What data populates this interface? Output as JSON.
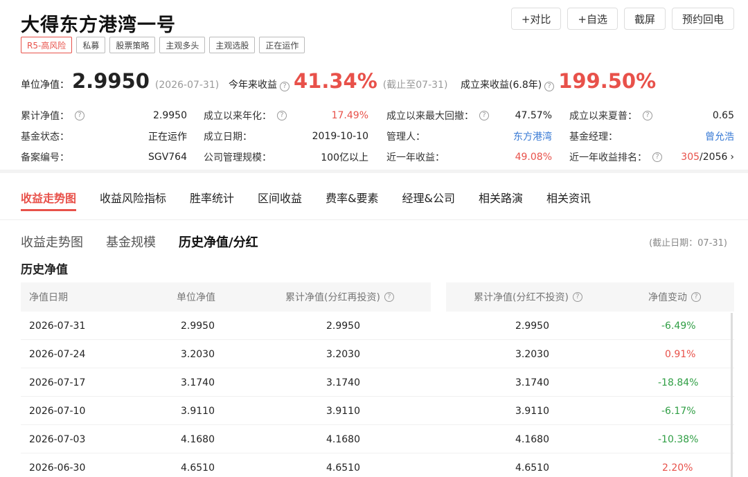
{
  "fund": {
    "title": "大得东方港湾一号",
    "tags": [
      "R5-高风险",
      "私募",
      "股票策略",
      "主观多头",
      "主观选股",
      "正在运作"
    ]
  },
  "actions": [
    "+对比",
    "+自选",
    "截屏",
    "预约回电"
  ],
  "kpis": {
    "nav_label": "单位净值：",
    "nav_value": "2.9950",
    "nav_date": "(2026-07-31)",
    "ytd_label": "今年来收益",
    "ytd_value": "41.34%",
    "ytd_note": "(截止至07-31)",
    "since_label": "成立来收益(6.8年)",
    "since_value": "199.50%"
  },
  "metrics": {
    "row1": [
      {
        "label": "累计净值：",
        "value": "2.9950",
        "help": true
      },
      {
        "label": "成立以来年化：",
        "value": "17.49%",
        "help": true,
        "color": "red"
      },
      {
        "label": "成立以来最大回撤：",
        "value": "47.57%",
        "help": true
      },
      {
        "label": "成立以来夏普：",
        "value": "0.65",
        "help": true
      }
    ],
    "row2": [
      {
        "label": "基金状态：",
        "value": "正在运作"
      },
      {
        "label": "成立日期：",
        "value": "2019-10-10"
      },
      {
        "label": "管理人：",
        "value": "东方港湾",
        "color": "blue"
      },
      {
        "label": "基金经理：",
        "value": "曾允浩",
        "color": "blue"
      }
    ],
    "row3": [
      {
        "label": "备案编号：",
        "value": "SGV764"
      },
      {
        "label": "公司管理规模：",
        "value": "100亿以上"
      },
      {
        "label": "近一年收益：",
        "value": "49.08%",
        "color": "red"
      },
      {
        "label": "近一年收益排名：",
        "value_rank": "305",
        "value_total": "/2056",
        "help": true
      }
    ]
  },
  "tabs": [
    "收益走势图",
    "收益风险指标",
    "胜率统计",
    "区间收益",
    "费率&要素",
    "经理&公司",
    "相关路演",
    "相关资讯"
  ],
  "subtabs": [
    "收益走势图",
    "基金规模",
    "历史净值/分红"
  ],
  "asof": "(截止日期：07-31)",
  "section_title": "历史净值",
  "table": {
    "headers": [
      "净值日期",
      "单位净值",
      "累计净值(分红再投资)",
      "累计净值(分红不投资)",
      "净值变动"
    ],
    "rows": [
      {
        "date": "2026-07-31",
        "unit": "2.9950",
        "cum_re": "2.9950",
        "cum_no": "2.9950",
        "chg": "-6.49%"
      },
      {
        "date": "2026-07-24",
        "unit": "3.2030",
        "cum_re": "3.2030",
        "cum_no": "3.2030",
        "chg": "0.91%"
      },
      {
        "date": "2026-07-17",
        "unit": "3.1740",
        "cum_re": "3.1740",
        "cum_no": "3.1740",
        "chg": "-18.84%"
      },
      {
        "date": "2026-07-10",
        "unit": "3.9110",
        "cum_re": "3.9110",
        "cum_no": "3.9110",
        "chg": "-6.17%"
      },
      {
        "date": "2026-07-03",
        "unit": "4.1680",
        "cum_re": "4.1680",
        "cum_no": "4.1680",
        "chg": "-10.38%"
      },
      {
        "date": "2026-06-30",
        "unit": "4.6510",
        "cum_re": "4.6510",
        "cum_no": "4.6510",
        "chg": "2.20%"
      }
    ]
  },
  "colors": {
    "accent": "#e8514a",
    "negative": "#2f9e44",
    "link": "#3a7bd5"
  }
}
